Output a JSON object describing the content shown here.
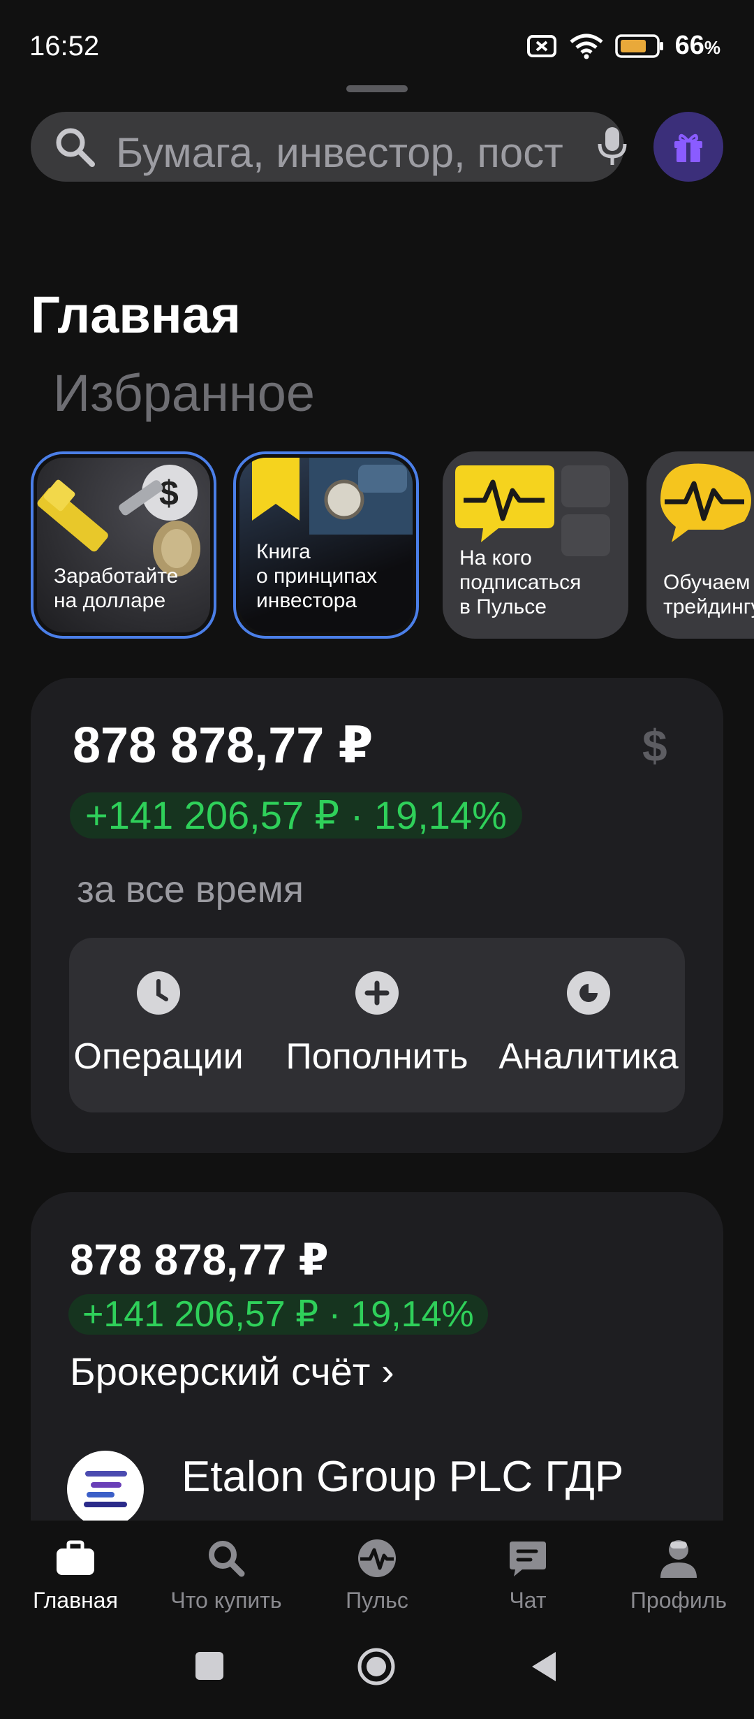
{
  "status_bar": {
    "time": "16:52",
    "battery_percent": "66",
    "battery_unit": "%",
    "icons": [
      "sim-off-icon",
      "wifi-icon",
      "battery-icon"
    ]
  },
  "search": {
    "placeholder": "Бумага, инвестор, пост"
  },
  "header": {
    "title": "Главная",
    "subtitle": "Избранное"
  },
  "stories": [
    {
      "label": "Заработайте\nна долларе"
    },
    {
      "label": "Книга\nо принципах\nинвестора"
    },
    {
      "label": "На кого\nподписаться\nв Пульсе"
    },
    {
      "label": "Обучаем\nтрейдингу"
    }
  ],
  "portfolio": {
    "total": "878 878,77 ₽",
    "currency_toggle": "$",
    "profit": "+141 206,57 ₽ · 19,14%",
    "period": "за все время",
    "actions": [
      {
        "label": "Операции",
        "icon": "clock-icon"
      },
      {
        "label": "Пополнить",
        "icon": "plus-icon"
      },
      {
        "label": "Аналитика",
        "icon": "pie-chart-icon"
      }
    ]
  },
  "broker": {
    "total": "878 878,77 ₽",
    "profit": "+141 206,57 ₽ · 19,14%",
    "link": "Брокерский счёт ›",
    "asset_name": "Etalon Group PLC ГДР"
  },
  "bottom_nav": [
    {
      "label": "Главная",
      "icon": "briefcase-icon",
      "active": true
    },
    {
      "label": "Что купить",
      "icon": "search-icon",
      "active": false
    },
    {
      "label": "Пульс",
      "icon": "pulse-icon",
      "active": false
    },
    {
      "label": "Чат",
      "icon": "chat-icon",
      "active": false
    },
    {
      "label": "Профиль",
      "icon": "profile-icon",
      "active": false
    }
  ],
  "colors": {
    "background": "#111111",
    "card": "#1e1e21",
    "profit_green": "#2fd05a",
    "story_border": "#4b7fe8",
    "gift_bg": "#3b2f7a"
  }
}
